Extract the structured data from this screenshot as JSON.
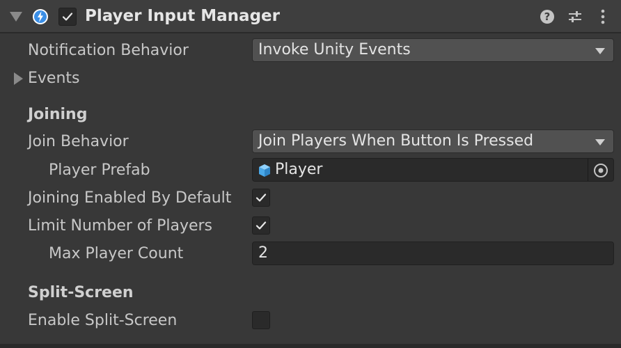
{
  "header": {
    "title": "Player Input Manager",
    "enabled": true
  },
  "fields": {
    "notification_behavior": {
      "label": "Notification Behavior",
      "value": "Invoke Unity Events"
    },
    "events": {
      "label": "Events"
    },
    "joining_section": "Joining",
    "join_behavior": {
      "label": "Join Behavior",
      "value": "Join Players When Button Is Pressed"
    },
    "player_prefab": {
      "label": "Player Prefab",
      "value": "Player"
    },
    "joining_enabled_by_default": {
      "label": "Joining Enabled By Default",
      "checked": true
    },
    "limit_number_of_players": {
      "label": "Limit Number of Players",
      "checked": true
    },
    "max_player_count": {
      "label": "Max Player Count",
      "value": "2"
    },
    "split_screen_section": "Split-Screen",
    "enable_split_screen": {
      "label": "Enable Split-Screen",
      "checked": false
    }
  },
  "icons": {
    "component": "lightning-bolt-icon",
    "help": "help-icon",
    "presets": "sliders-icon",
    "menu": "kebab-menu-icon",
    "prefab": "cube-icon",
    "picker": "object-picker-icon"
  },
  "colors": {
    "background": "#383838",
    "header": "#3e3e3e",
    "dropdown": "#515151",
    "field": "#2a2a2a",
    "prefab_icon": "#5bb7f0"
  }
}
